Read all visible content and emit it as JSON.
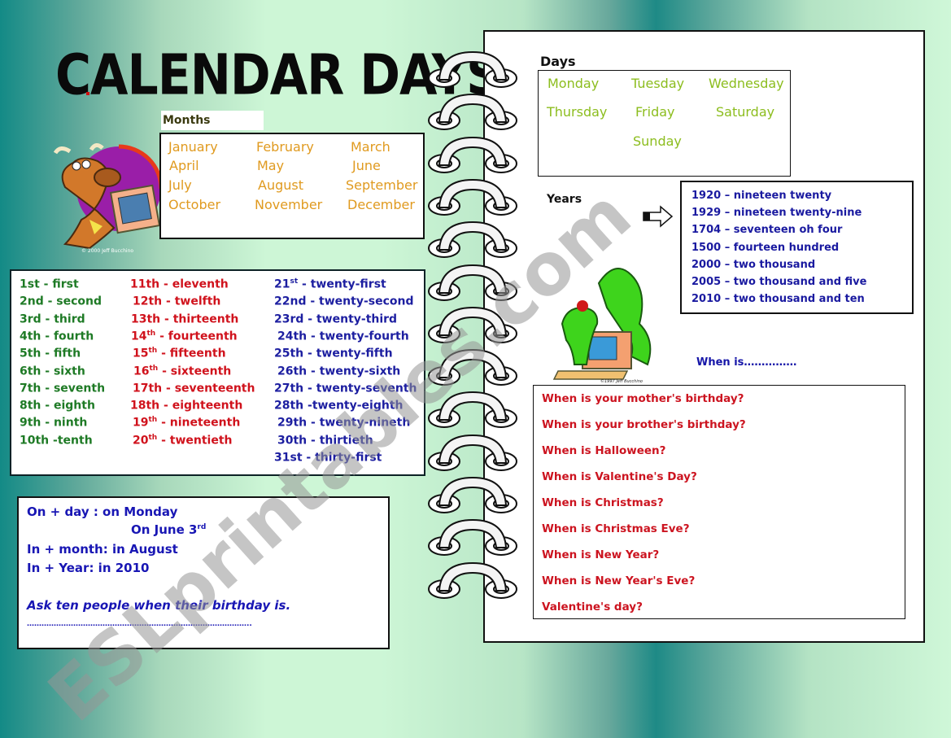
{
  "title": "CALENDAR DAYS",
  "months": {
    "label": "Months",
    "rows": [
      [
        "January",
        "February",
        "March"
      ],
      [
        "April",
        "May",
        "June"
      ],
      [
        "July",
        "August",
        "September"
      ],
      [
        "October",
        "November",
        "December"
      ]
    ]
  },
  "ordinals": {
    "col1": [
      {
        "num": "1st",
        "sup": "",
        "word": " - first"
      },
      {
        "num": "2nd",
        "sup": "",
        "word": " - second"
      },
      {
        "num": "3rd",
        "sup": "",
        "word": " - third"
      },
      {
        "num": "4th",
        "sup": "",
        "word": " - fourth"
      },
      {
        "num": "5th",
        "sup": "",
        "word": " - fifth"
      },
      {
        "num": "6th",
        "sup": "",
        "word": " - sixth"
      },
      {
        "num": "7th",
        "sup": "",
        "word": " - seventh"
      },
      {
        "num": "8th",
        "sup": "",
        "word": " - eighth"
      },
      {
        "num": "9th",
        "sup": "",
        "word": " - ninth"
      },
      {
        "num": "10th",
        "sup": "",
        "word": " -tenth"
      }
    ],
    "col2": [
      {
        "num": "11th",
        "sup": "",
        "word": " - eleventh"
      },
      {
        "num": "12th",
        "sup": "",
        "word": " - twelfth"
      },
      {
        "num": "13th",
        "sup": "",
        "word": " - thirteenth"
      },
      {
        "num": "14",
        "sup": "th",
        "word": " - fourteenth"
      },
      {
        "num": "15",
        "sup": "th",
        "word": " - fifteenth"
      },
      {
        "num": "16",
        "sup": "th",
        "word": " - sixteenth"
      },
      {
        "num": "17th",
        "sup": "",
        "word": " - seventeenth"
      },
      {
        "num": "18th",
        "sup": "",
        "word": " - eighteenth"
      },
      {
        "num": "19",
        "sup": "th",
        "word": " - nineteenth"
      },
      {
        "num": "20",
        "sup": "th",
        "word": " - twentieth"
      }
    ],
    "col3": [
      {
        "num": "21",
        "sup": "st",
        "word": " - twenty-first"
      },
      {
        "num": "22nd",
        "sup": "",
        "word": " - twenty-second"
      },
      {
        "num": "23rd",
        "sup": "",
        "word": " - twenty-third"
      },
      {
        "num": "24th",
        "sup": "",
        "word": " - twenty-fourth"
      },
      {
        "num": "25th",
        "sup": "",
        "word": " - twenty-fifth"
      },
      {
        "num": "26th",
        "sup": "",
        "word": " - twenty-sixth"
      },
      {
        "num": "27th",
        "sup": "",
        "word": " - twenty-seventh"
      },
      {
        "num": "28th",
        "sup": "",
        "word": " -twenty-eighth"
      },
      {
        "num": "29th",
        "sup": "",
        "word": " - twenty-nineth"
      },
      {
        "num": "30th",
        "sup": "",
        "word": " - thirtieth"
      },
      {
        "num": "31st",
        "sup": "",
        "word": " - thirty-first"
      }
    ]
  },
  "rules": {
    "line1": "On + day : on Monday",
    "line2": "On June 3",
    "line2_sup": "rd",
    "line3": "In + month: in August",
    "line4": "In + Year: in 2010",
    "task": "Ask ten people when their birthday is.",
    "answer_line": "……………………………………………………………………………….."
  },
  "days": {
    "label": "Days",
    "items": [
      "Monday",
      "Tuesday",
      "Wednesday",
      "Thursday",
      "Friday",
      "Saturday",
      "Sunday"
    ]
  },
  "years": {
    "label": "Years",
    "items": [
      "1920 – nineteen twenty",
      "1929 – nineteen twenty-nine",
      "1704 – seventeen oh four",
      "1500 – fourteen hundred",
      "2000 – two thousand",
      "2005 – two thousand and five",
      "2010 – two thousand and ten"
    ]
  },
  "when_is": "When is……………",
  "questions": [
    "When is your mother's birthday?",
    "When is your brother's birthday?",
    "When is Halloween?",
    "When is Valentine's Day?",
    "When is Christmas?",
    "When is Christmas Eve?",
    "When is New Year?",
    "When is New Year's Eve?",
    "Valentine's day?"
  ],
  "illustrations": {
    "cow_credit": "© 2000 Jeff Bucchino",
    "dragon_credit": "©1997 Jeff Bucchino"
  },
  "watermark": "ESLprintables.com",
  "colors": {
    "months": "#e09a1f",
    "ordinals_1_10": "#1e7a25",
    "ordinals_11_20": "#d0121c",
    "ordinals_21_31": "#1c1ea0",
    "days": "#8cbd1e",
    "years": "#1a1aa0",
    "questions": "#cc1420"
  }
}
